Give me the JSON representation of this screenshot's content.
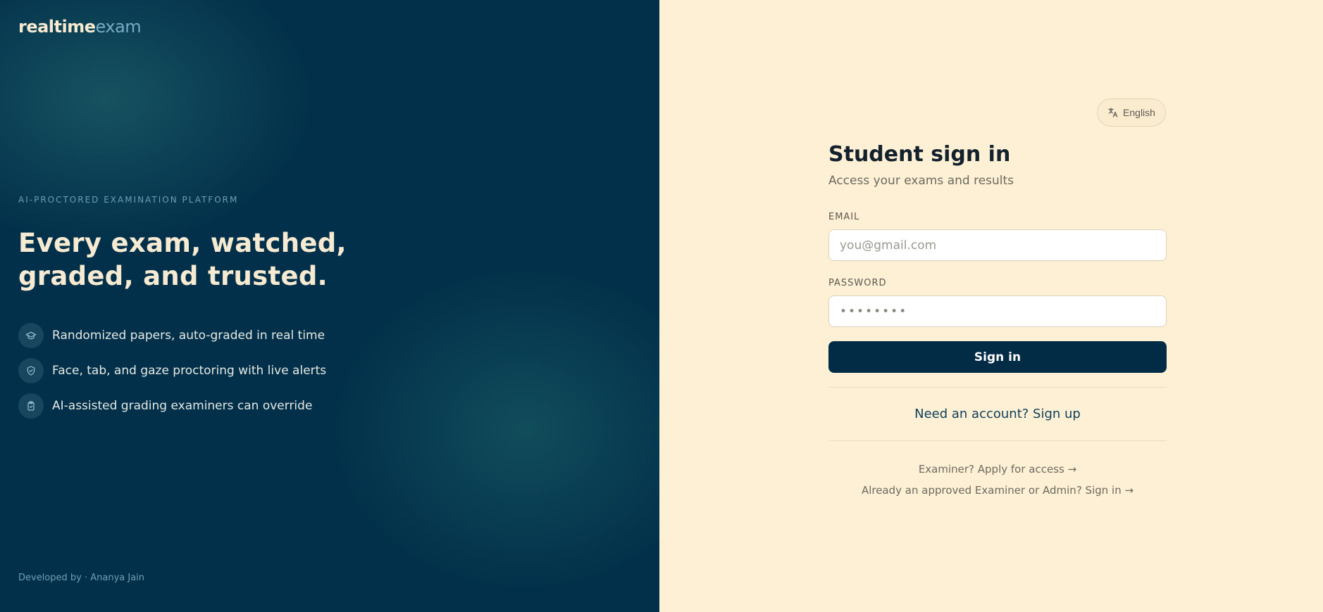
{
  "brand": {
    "name_part1": "realtime",
    "name_part2": "exam"
  },
  "hero": {
    "eyebrow": "AI-PROCTORED EXAMINATION PLATFORM",
    "headline": "Every exam, watched, graded, and trusted.",
    "features": [
      {
        "icon": "graduation-cap-icon",
        "text": "Randomized papers, auto-graded in real time"
      },
      {
        "icon": "shield-check-icon",
        "text": "Face, tab, and gaze proctoring with live alerts"
      },
      {
        "icon": "clipboard-check-icon",
        "text": "AI-assisted grading examiners can override"
      }
    ],
    "credit": "Developed by · Ananya Jain"
  },
  "language": {
    "label": "English",
    "icon": "translate-icon"
  },
  "form": {
    "title": "Student sign in",
    "subtitle": "Access your exams and results",
    "email_label": "EMAIL",
    "email_placeholder": "you@gmail.com",
    "email_value": "",
    "password_label": "PASSWORD",
    "password_placeholder": "••••••••",
    "password_value": "",
    "submit_label": "Sign in",
    "signup_link": "Need an account? Sign up",
    "examiner_link": "Examiner? Apply for access →",
    "admin_link": "Already an approved Examiner or Admin? Sign in →"
  },
  "colors": {
    "left_bg": "#02304a",
    "right_bg": "#fdf0d5",
    "accent": "#022b45",
    "brand_secondary": "#79aac6"
  }
}
